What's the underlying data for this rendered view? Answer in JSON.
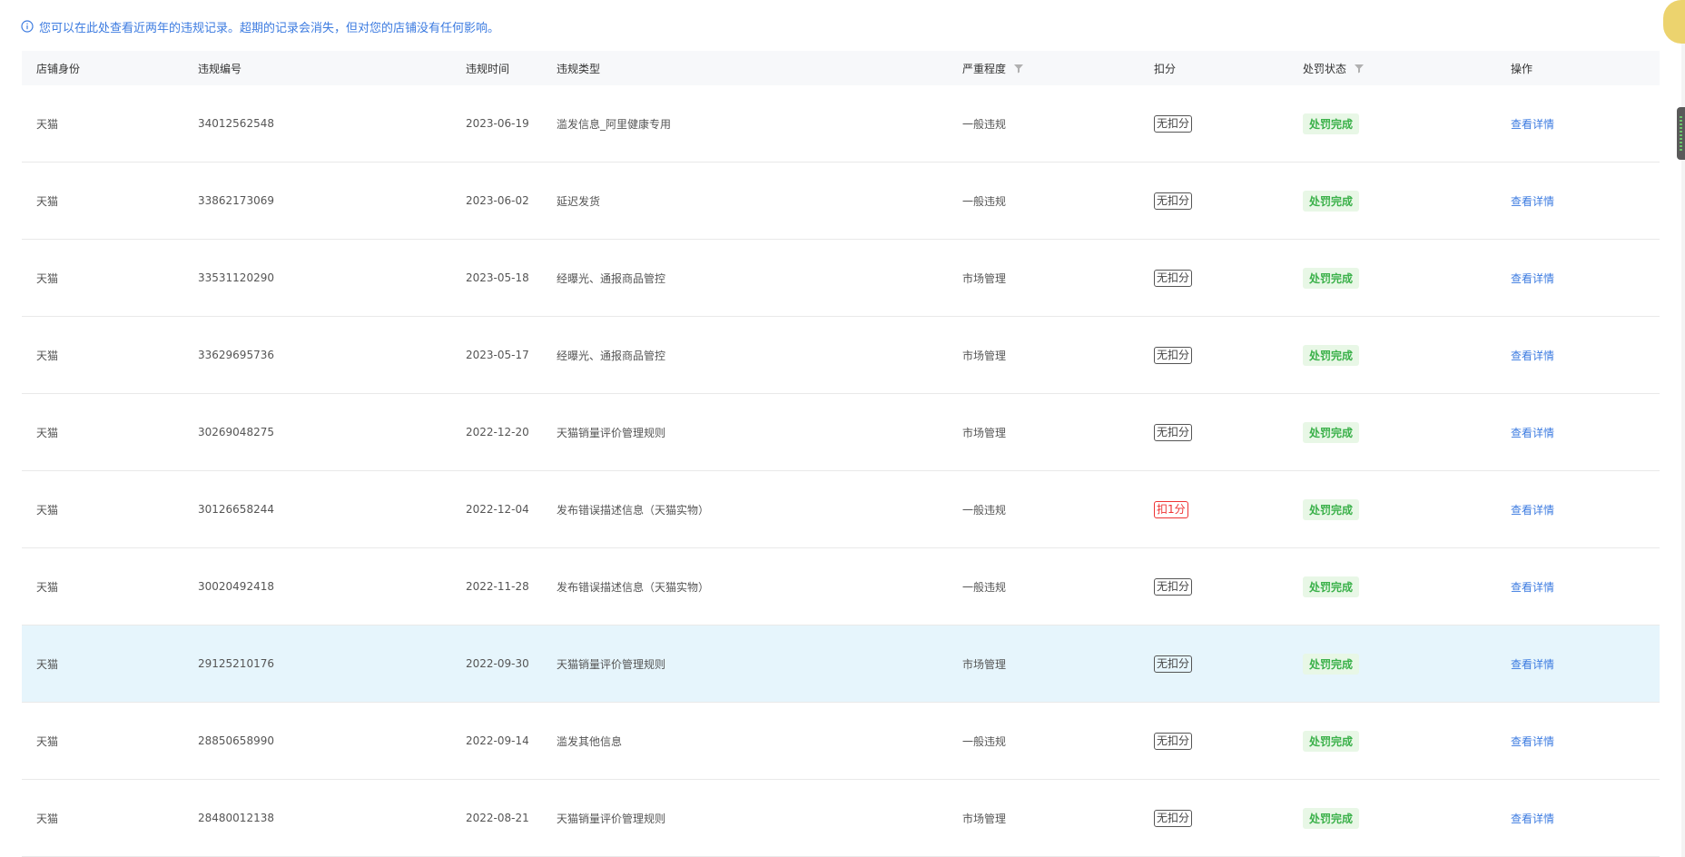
{
  "notice": {
    "text": "您可以在此处查看近两年的违规记录。超期的记录会消失，但对您的店铺没有任何影响。"
  },
  "columns": [
    "店铺身份",
    "违规编号",
    "违规时间",
    "违规类型",
    "严重程度",
    "扣分",
    "处罚状态",
    "操作"
  ],
  "rows": [
    {
      "shop": "天猫",
      "id": "34012562548",
      "date": "2023-06-19",
      "type": "滥发信息_阿里健康专用",
      "severity": "一般违规",
      "points": "无扣分",
      "status": "处罚完成",
      "action": "查看详情"
    },
    {
      "shop": "天猫",
      "id": "33862173069",
      "date": "2023-06-02",
      "type": "延迟发货",
      "severity": "一般违规",
      "points": "无扣分",
      "status": "处罚完成",
      "action": "查看详情"
    },
    {
      "shop": "天猫",
      "id": "33531120290",
      "date": "2023-05-18",
      "type": "经曝光、通报商品管控",
      "severity": "市场管理",
      "points": "无扣分",
      "status": "处罚完成",
      "action": "查看详情"
    },
    {
      "shop": "天猫",
      "id": "33629695736",
      "date": "2023-05-17",
      "type": "经曝光、通报商品管控",
      "severity": "市场管理",
      "points": "无扣分",
      "status": "处罚完成",
      "action": "查看详情"
    },
    {
      "shop": "天猫",
      "id": "30269048275",
      "date": "2022-12-20",
      "type": "天猫销量评价管理规则",
      "severity": "市场管理",
      "points": "无扣分",
      "status": "处罚完成",
      "action": "查看详情"
    },
    {
      "shop": "天猫",
      "id": "30126658244",
      "date": "2022-12-04",
      "type": "发布错误描述信息（天猫实物）",
      "severity": "一般违规",
      "points": "扣1分",
      "status": "处罚完成",
      "action": "查看详情"
    },
    {
      "shop": "天猫",
      "id": "30020492418",
      "date": "2022-11-28",
      "type": "发布错误描述信息（天猫实物）",
      "severity": "一般违规",
      "points": "无扣分",
      "status": "处罚完成",
      "action": "查看详情"
    },
    {
      "shop": "天猫",
      "id": "29125210176",
      "date": "2022-09-30",
      "type": "天猫销量评价管理规则",
      "severity": "市场管理",
      "points": "无扣分",
      "status": "处罚完成",
      "action": "查看详情"
    },
    {
      "shop": "天猫",
      "id": "28850658990",
      "date": "2022-09-14",
      "type": "滥发其他信息",
      "severity": "一般违规",
      "points": "无扣分",
      "status": "处罚完成",
      "action": "查看详情"
    },
    {
      "shop": "天猫",
      "id": "28480012138",
      "date": "2022-08-21",
      "type": "天猫销量评价管理规则",
      "severity": "市场管理",
      "points": "无扣分",
      "status": "处罚完成",
      "action": "查看详情"
    }
  ],
  "colors": {
    "link": "#3c7be0",
    "status_green": "#3bb14a",
    "status_bg": "#e8f7e6",
    "penalty_red": "#e33333",
    "row_highlight": "#e6f5fc",
    "header_bg": "#f7f8fa"
  }
}
